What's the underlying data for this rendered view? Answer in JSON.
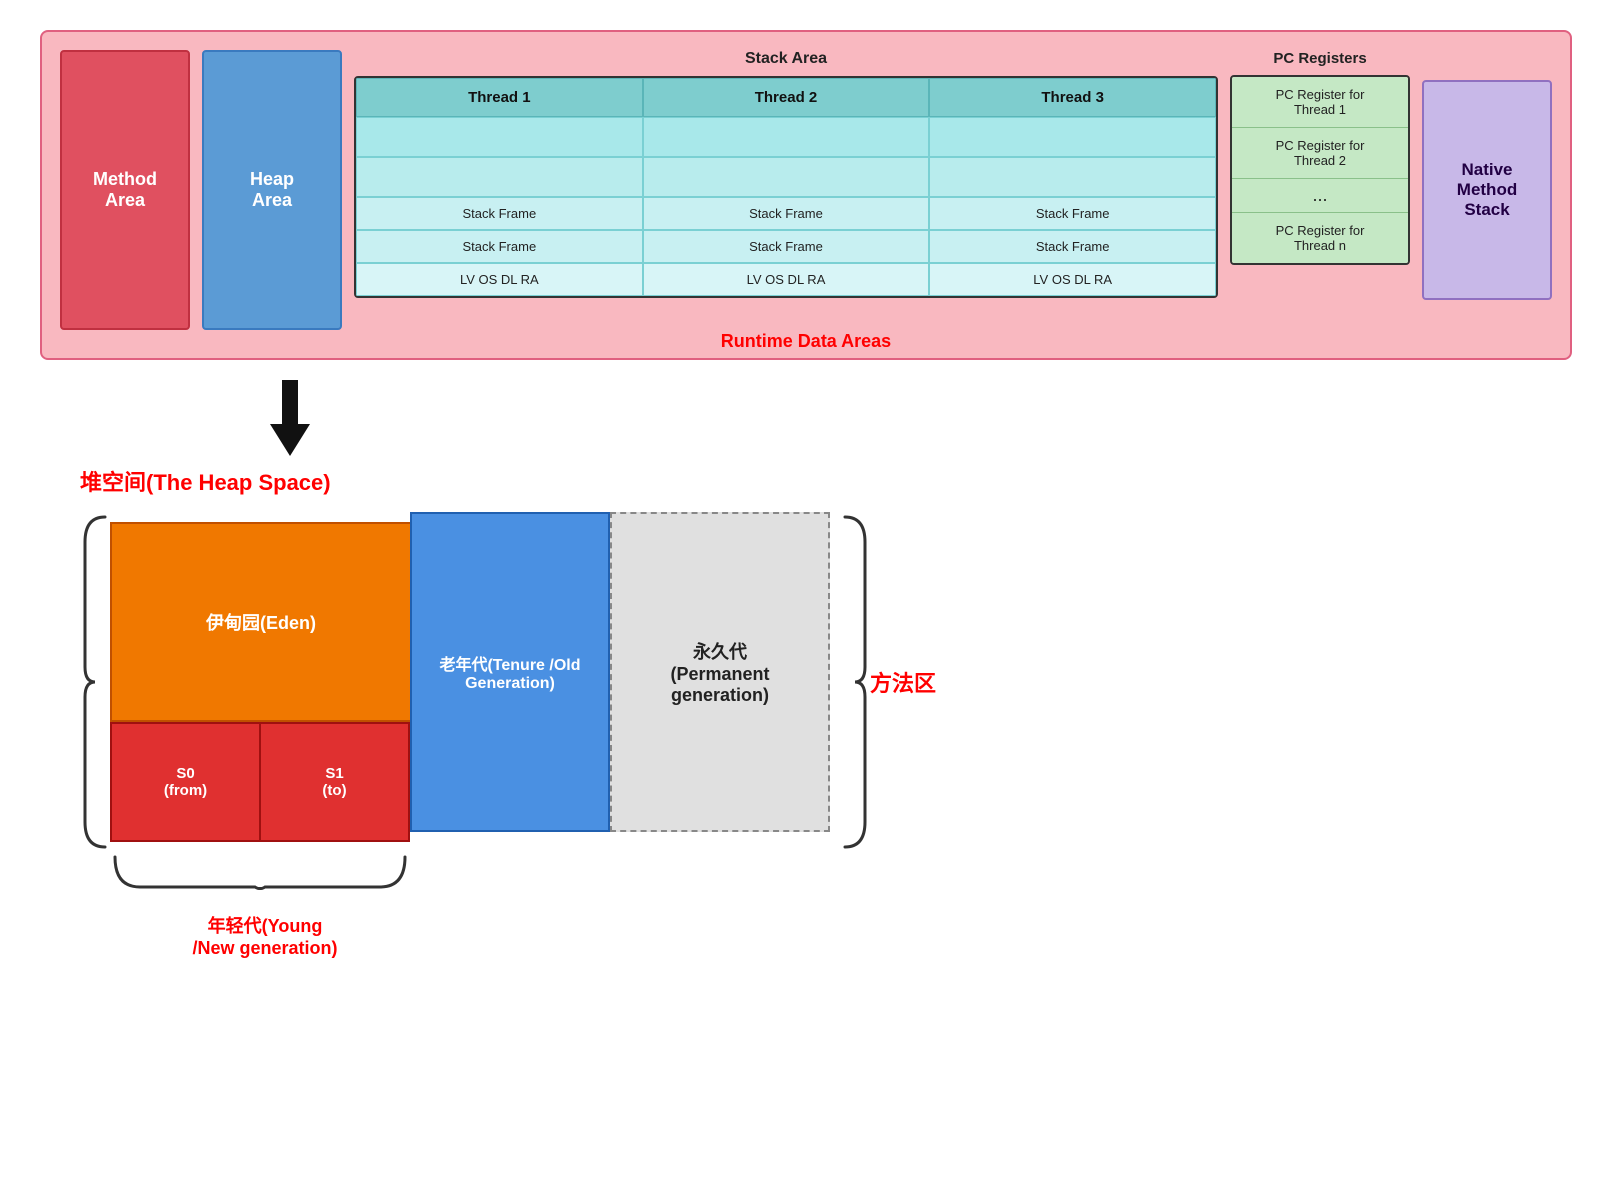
{
  "runtime": {
    "label": "Runtime Data Areas",
    "method_area": "Method\nArea",
    "heap_area": "Heap\nArea",
    "stack_area_label": "Stack Area",
    "pc_registers_label": "PC Registers",
    "native_method_stack": "Native\nMethod\nStack",
    "threads": [
      "Thread 1",
      "Thread 2",
      "Thread 3"
    ],
    "stack_frames_row1": [
      "Stack Frame",
      "Stack Frame",
      "Stack Frame"
    ],
    "stack_frames_row2": [
      "Stack Frame",
      "Stack Frame",
      "Stack Frame"
    ],
    "lv_rows": [
      "LV OS DL RA",
      "LV OS DL RA",
      "LV OS DL RA"
    ],
    "pc_registers": [
      "PC Register for\nThread 1",
      "PC Register for\nThread 2",
      "...",
      "PC Register for\nThread n"
    ]
  },
  "heap_space": {
    "title": "堆空间(The Heap Space)",
    "eden_label": "伊甸园(Eden)",
    "s0_label": "S0\n(from)",
    "s1_label": "S1\n(to)",
    "old_gen_label": "老年代(Tenure /Old\nGeneration)",
    "perm_gen_label": "永久代\n(Permanent\ngeneration)",
    "method_area_label": "方法区",
    "young_gen_label": "年轻代(Young\n/New generation)"
  }
}
